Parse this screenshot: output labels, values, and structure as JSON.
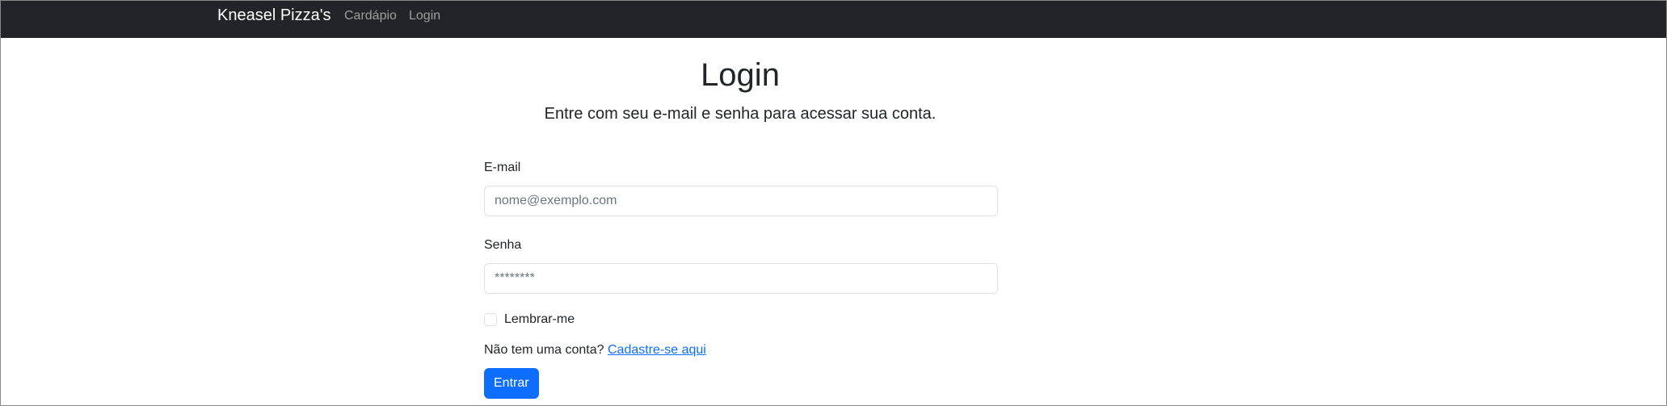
{
  "navbar": {
    "brand": "Kneasel Pizza's",
    "links": [
      {
        "label": "Cardápio"
      },
      {
        "label": "Login"
      }
    ]
  },
  "page": {
    "title": "Login",
    "subtitle": "Entre com seu e-mail e senha para acessar sua conta."
  },
  "form": {
    "email": {
      "label": "E-mail",
      "placeholder": "nome@exemplo.com",
      "value": ""
    },
    "password": {
      "label": "Senha",
      "placeholder": "********",
      "value": ""
    },
    "remember": {
      "label": "Lembrar-me",
      "checked": false
    },
    "signup": {
      "text": "Não tem uma conta?",
      "link": "Cadastre-se aqui"
    },
    "submit": "Entrar"
  },
  "colors": {
    "navbar": "#212529",
    "primary": "#0d6efd"
  }
}
